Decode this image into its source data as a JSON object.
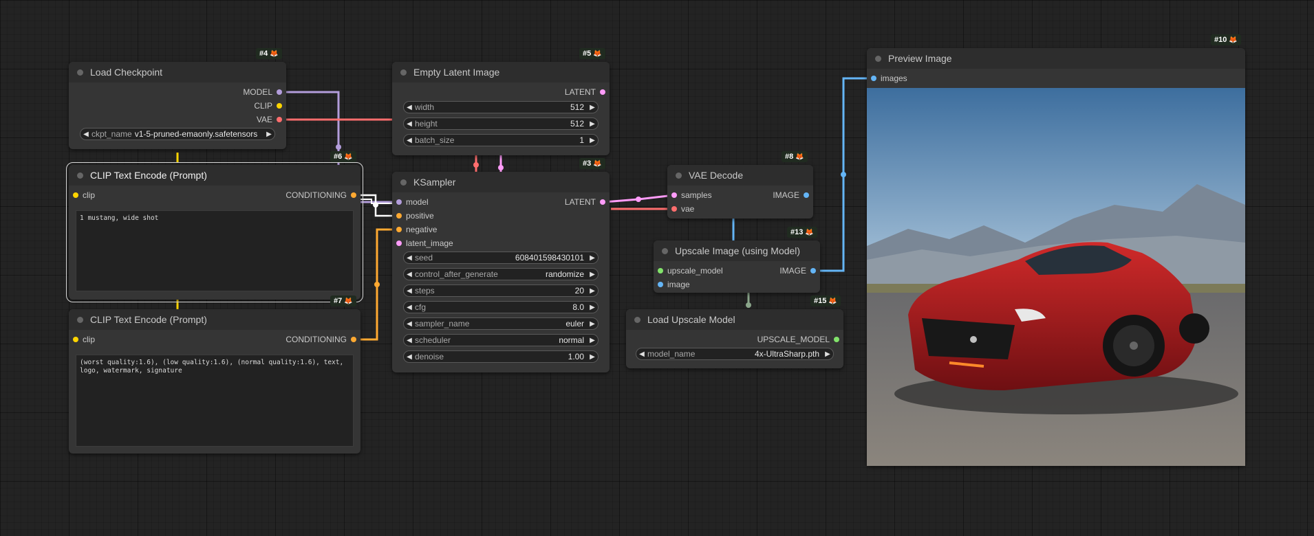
{
  "colors": {
    "model": "#b39ddb",
    "clip": "#ffd500",
    "vae": "#ff6e6e",
    "latent": "#ff9cf9",
    "conditioning": "#ffa931",
    "image": "#64b5f6",
    "upscale_model": "#82e36b"
  },
  "nodes": {
    "load_checkpoint": {
      "id": "#4",
      "title": "Load Checkpoint",
      "outputs": [
        "MODEL",
        "CLIP",
        "VAE"
      ],
      "widgets": [
        {
          "name": "ckpt_name",
          "value": "v1-5-pruned-emaonly.safetensors"
        }
      ]
    },
    "clip_positive": {
      "id": "#6",
      "title": "CLIP Text Encode (Prompt)",
      "input": "clip",
      "output": "CONDITIONING",
      "text": "1 mustang, wide shot"
    },
    "clip_negative": {
      "id": "#7",
      "title": "CLIP Text Encode (Prompt)",
      "input": "clip",
      "output": "CONDITIONING",
      "text": "(worst quality:1.6), (low quality:1.6), (normal quality:1.6), text, logo, watermark, signature"
    },
    "empty_latent": {
      "id": "#5",
      "title": "Empty Latent Image",
      "output": "LATENT",
      "widgets": [
        {
          "name": "width",
          "value": "512"
        },
        {
          "name": "height",
          "value": "512"
        },
        {
          "name": "batch_size",
          "value": "1"
        }
      ]
    },
    "ksampler": {
      "id": "#3",
      "title": "KSampler",
      "output": "LATENT",
      "inputs": [
        "model",
        "positive",
        "negative",
        "latent_image"
      ],
      "widgets": [
        {
          "name": "seed",
          "value": "608401598430101"
        },
        {
          "name": "control_after_generate",
          "value": "randomize"
        },
        {
          "name": "steps",
          "value": "20"
        },
        {
          "name": "cfg",
          "value": "8.0"
        },
        {
          "name": "sampler_name",
          "value": "euler"
        },
        {
          "name": "scheduler",
          "value": "normal"
        },
        {
          "name": "denoise",
          "value": "1.00"
        }
      ]
    },
    "vae_decode": {
      "id": "#8",
      "title": "VAE Decode",
      "inputs": [
        "samples",
        "vae"
      ],
      "output": "IMAGE"
    },
    "upscale_image": {
      "id": "#13",
      "title": "Upscale Image (using Model)",
      "inputs": [
        "upscale_model",
        "image"
      ],
      "output": "IMAGE"
    },
    "load_upscale": {
      "id": "#15",
      "title": "Load Upscale Model",
      "output": "UPSCALE_MODEL",
      "widgets": [
        {
          "name": "model_name",
          "value": "4x-UltraSharp.pth"
        }
      ]
    },
    "preview": {
      "id": "#10",
      "title": "Preview Image",
      "input": "images"
    }
  }
}
